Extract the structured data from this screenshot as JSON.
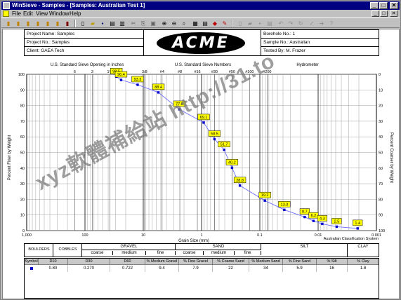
{
  "window": {
    "title": "WinSieve - Samples - [Samples: Australian Test 1]",
    "controls": {
      "minimize": "_",
      "maximize": "□",
      "close": "✕"
    }
  },
  "menu": [
    "File",
    "Edit",
    "View",
    "Window",
    "Help"
  ],
  "toolbar": {
    "icons": [
      "new-file-icon",
      "open-folder-icon",
      "save-icon",
      "print-icon",
      "print-preview-icon",
      "cut-icon",
      "copy-icon",
      "paste-icon",
      "zoom-in-icon",
      "zoom-out-icon",
      "find-icon",
      "chart-icon",
      "table-icon",
      "edit-icon",
      "undo-icon",
      "redo-icon",
      "help-icon"
    ]
  },
  "header": {
    "project_name": "Project Name: Samples",
    "project_no": "Project No.: Samples",
    "client": "Client: GAEA Tech",
    "logo": "ACME",
    "borehole": "Borehole No.: 1",
    "sample": "Sample No.: Australian",
    "tested_by": "Tested By: M. Frazer"
  },
  "chart_data": {
    "type": "line",
    "xscale": "log",
    "xreversed": true,
    "xlim": [
      1000,
      0.001
    ],
    "ylim": [
      0,
      100
    ],
    "xlabel": "Grain Size (mm)",
    "ylabel_left": "Percent Finer by Weight",
    "ylabel_right": "Percent Coarser by Weight",
    "top_axis_inches": "U.S. Standard Sieve Opening in Inches",
    "top_axis_numbers": "U.S. Standard Sieve Numbers",
    "top_axis_hydrometer": "Hydrometer",
    "x_tick_labels": [
      "1,000",
      "100",
      "10",
      "1",
      "0.1",
      "0.01",
      "0.001"
    ],
    "y_ticks": [
      0,
      10,
      20,
      30,
      40,
      50,
      60,
      70,
      80,
      90,
      100
    ],
    "y_right_ticks": [
      100,
      90,
      80,
      70,
      60,
      50,
      40,
      30,
      20,
      10,
      0
    ],
    "inch_sieves": [
      {
        "label": "6",
        "x": 150
      },
      {
        "label": "3",
        "x": 75
      },
      {
        "label": "1½",
        "x": 37.5
      },
      {
        "label": "3/8",
        "x": 9.5
      }
    ],
    "number_sieves": [
      {
        "label": "#4",
        "x": 4.75
      },
      {
        "label": "#8",
        "x": 2.36
      },
      {
        "label": "#16",
        "x": 1.18
      },
      {
        "label": "#30",
        "x": 0.6
      },
      {
        "label": "#50",
        "x": 0.3
      },
      {
        "label": "#100",
        "x": 0.15
      },
      {
        "label": "#200",
        "x": 0.075
      }
    ],
    "points": [
      {
        "x": 29,
        "y": 98.5,
        "label": "98.5"
      },
      {
        "x": 24,
        "y": 96.4,
        "label": "96.4"
      },
      {
        "x": 12.5,
        "y": 93.3,
        "label": "93.3"
      },
      {
        "x": 5.5,
        "y": 88.4,
        "label": "88.4"
      },
      {
        "x": 2.4,
        "y": 77.6,
        "label": "77.6"
      },
      {
        "x": 0.92,
        "y": 69.1,
        "label": "69.1"
      },
      {
        "x": 0.6,
        "y": 58.5,
        "label": "58.5"
      },
      {
        "x": 0.41,
        "y": 51.7,
        "label": "51.7"
      },
      {
        "x": 0.3,
        "y": 40.2,
        "label": "40.2"
      },
      {
        "x": 0.22,
        "y": 28.8,
        "label": "28.8"
      },
      {
        "x": 0.082,
        "y": 19.2,
        "label": "19.2"
      },
      {
        "x": 0.038,
        "y": 13.3,
        "label": "13.3"
      },
      {
        "x": 0.017,
        "y": 8.7,
        "label": "8.7"
      },
      {
        "x": 0.012,
        "y": 6.2,
        "label": "6.2"
      },
      {
        "x": 0.0085,
        "y": 4.3,
        "label": "4.3"
      },
      {
        "x": 0.0048,
        "y": 2.5,
        "label": "2.5"
      },
      {
        "x": 0.0021,
        "y": 1.4,
        "label": "1.4"
      }
    ]
  },
  "classification": {
    "boulders": "BOULDERS",
    "cobbles": "COBBLES",
    "gravel": "GRAVEL",
    "gravel_coarse": "coarse",
    "gravel_medium": "medium",
    "gravel_fine": "fine",
    "sand": "SAND",
    "sand_coarse": "coarse",
    "sand_medium": "medium",
    "sand_fine": "fine",
    "silt": "SILT",
    "clay": "CLAY",
    "system": "Australian Classification System"
  },
  "summary": {
    "headers": [
      "Symbol",
      "D10",
      "D30",
      "D60",
      "% Medium Gravel",
      "% Fine Gravel",
      "% Coarse Sand",
      "% Medium Sand",
      "% Fine Sand",
      "% Silt",
      "% Clay"
    ],
    "row": [
      "",
      "0.80",
      "0.270",
      "0.722",
      "9.4",
      "7.9",
      "22",
      "34",
      "5.9",
      "16",
      "1.8"
    ]
  },
  "watermark": "xyz軟體補給站 http://31.to",
  "colors": {
    "curve": "#7070ff",
    "marker": "#0000cc",
    "label_bg": "#ffff00",
    "title_bar": "#000080"
  }
}
